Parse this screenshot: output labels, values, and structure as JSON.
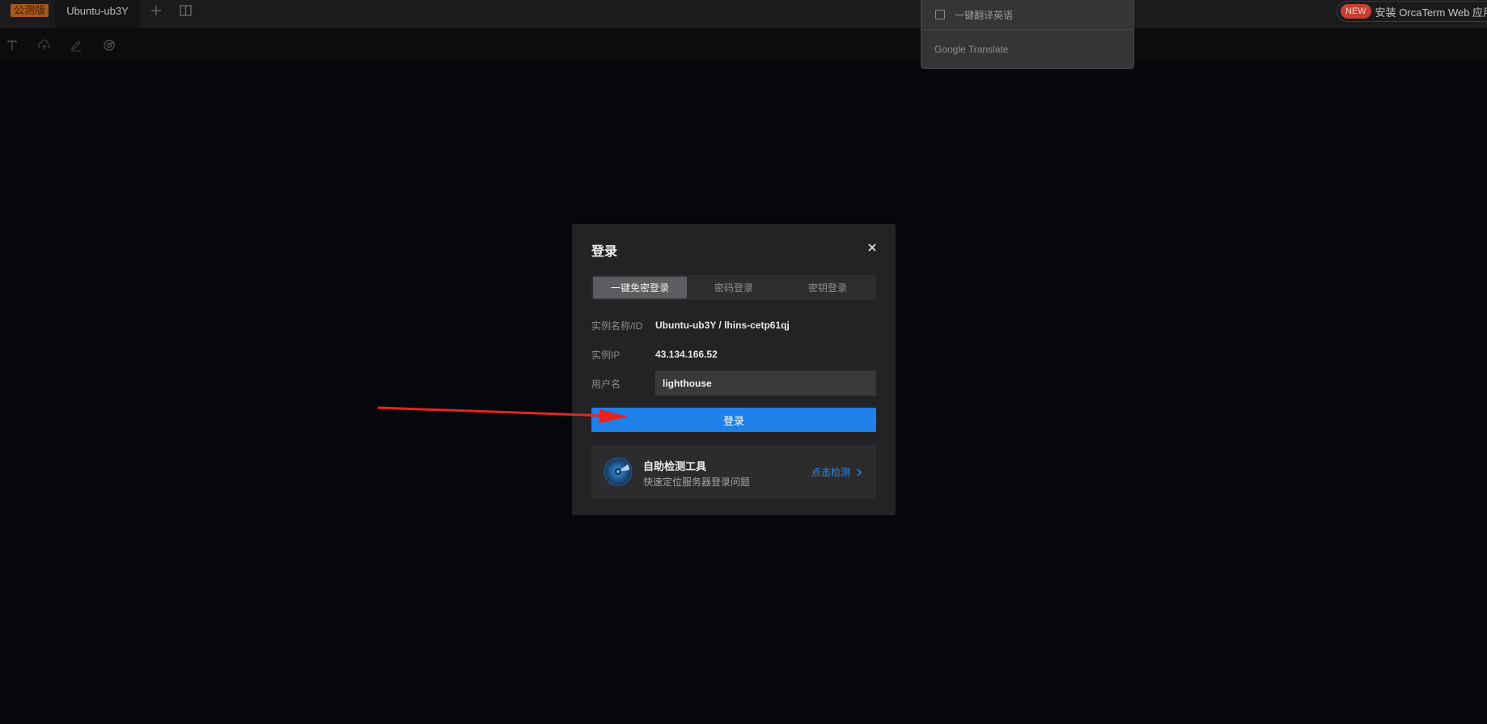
{
  "topbar": {
    "beta_badge": "公测版",
    "active_tab": "Ubuntu-ub3Y",
    "install_new_badge": "NEW",
    "install_text": "安装 OrcaTerm Web 应用"
  },
  "translate_popup": {
    "option_label": "一键翻译英语",
    "brand": "Google Translate"
  },
  "dialog": {
    "title": "登录",
    "tabs": [
      {
        "label": "一键免密登录",
        "active": true
      },
      {
        "label": "密码登录",
        "active": false
      },
      {
        "label": "密钥登录",
        "active": false
      }
    ],
    "instance_name_label": "实例名称/ID",
    "instance_name_value": "Ubuntu-ub3Y / lhins-cetp61qj",
    "instance_ip_label": "实例IP",
    "instance_ip_value": "43.134.166.52",
    "username_label": "用户名",
    "username_value": "lighthouse",
    "login_button": "登录",
    "self_check": {
      "title": "自助检测工具",
      "description": "快速定位服务器登录问题",
      "link": "点击检测"
    }
  },
  "colors": {
    "background": "#06070b",
    "dialog": "#232325",
    "primary": "#1e80e8",
    "link": "#2f8cf0",
    "annotation_arrow": "#e8231f"
  }
}
